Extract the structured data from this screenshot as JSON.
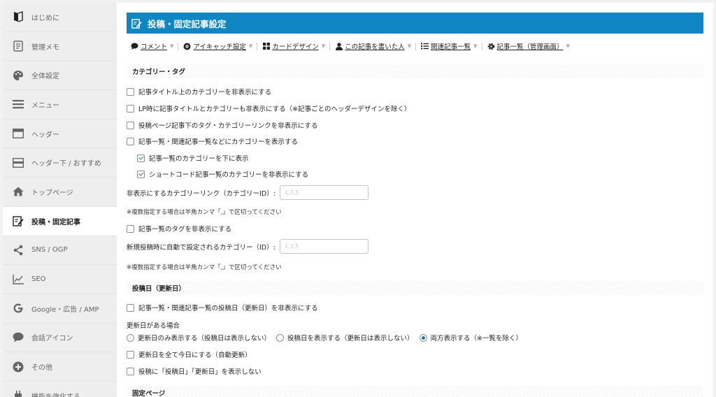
{
  "sidebar": {
    "items": [
      {
        "label": "はじめに",
        "icon": "book-half-icon"
      },
      {
        "label": "管理メモ",
        "icon": "memo-icon"
      },
      {
        "label": "全体設定",
        "icon": "palette-icon"
      },
      {
        "label": "メニュー",
        "icon": "menu-icon"
      },
      {
        "label": "ヘッダー",
        "icon": "header-icon"
      },
      {
        "label": "ヘッダー下 / おすすめ",
        "icon": "under-header-icon"
      },
      {
        "label": "トップページ",
        "icon": "home-icon"
      },
      {
        "label": "投稿・固定記事",
        "icon": "post-edit-icon"
      },
      {
        "label": "SNS / OGP",
        "icon": "share-icon"
      },
      {
        "label": "SEO",
        "icon": "chart-line-icon"
      },
      {
        "label": "Google・広告 / AMP",
        "icon": "google-icon"
      },
      {
        "label": "会話アイコン",
        "icon": "speech-bubble-icon"
      },
      {
        "label": "その他",
        "icon": "plus-circle-icon"
      },
      {
        "label": "機能を強化する",
        "icon": "plug-icon"
      }
    ]
  },
  "header": {
    "title": "投稿・固定記事設定"
  },
  "tabs": [
    {
      "label": "コメント",
      "icon": "comment-icon"
    },
    {
      "label": "アイキャッチ設定",
      "icon": "eye-icon"
    },
    {
      "label": "カードデザイン",
      "icon": "grid-icon"
    },
    {
      "label": "この記事を書いた人",
      "icon": "user-icon"
    },
    {
      "label": "関連記事一覧",
      "icon": "list-icon"
    },
    {
      "label": "記事一覧（管理画面）",
      "icon": "gear-icon"
    }
  ],
  "category_section": {
    "title": "カテゴリー・タグ",
    "options": {
      "hide_category_above_title": "記事タイトル上のカテゴリーを非表示にする",
      "hide_title_category_lp": "LP時に記事タイトルとカテゴリーも非表示にする（※記事ごとのヘッダーデザインを除く）",
      "hide_post_tag_links": "投稿ページ記事下のタグ・カテゴリーリンクを非表示にする",
      "show_category_in_lists": "記事一覧・関連記事一覧などにカテゴリーを表示する",
      "category_bottom": "記事一覧のカテゴリーを下に表示",
      "hide_shortcode_category": "ショートコード記事一覧のカテゴリーを非表示にする",
      "hide_list_tags": "記事一覧のタグを非表示にする"
    },
    "hidden_category_label": "非表示にするカテゴリーリンク（カテゴリーID）:",
    "hidden_category_placeholder": "1,3,5",
    "note1": "※複数指定する場合は半角カンマ「,」で区切ってください",
    "auto_category_label": "新規投稿時に自動で設定されるカテゴリー（ID）:",
    "auto_category_placeholder": "1,3,5",
    "note2": "※複数指定する場合は半角カンマ「,」で区切ってください"
  },
  "date_section": {
    "title": "投稿日（更新日）",
    "hide_dates_in_lists": "記事一覧・関連記事一覧の投稿日（更新日）を非表示にする",
    "updated_heading": "更新日がある場合",
    "radio_options": [
      "更新日のみ表示する（投稿日は表示しない）",
      "投稿日を表示する（更新日は表示しない）",
      "両方表示する（※一覧を除く）"
    ],
    "radio_selected": "両方表示する（※一覧を除く）",
    "set_today": "更新日を全て今日にする（自動更新）",
    "hide_labels": "投稿に「投稿日」「更新日」を表示しない"
  },
  "page_section": {
    "title": "固定ページ"
  },
  "colors": {
    "accent": "#0d86c3",
    "checkbox": "#2271b1"
  }
}
